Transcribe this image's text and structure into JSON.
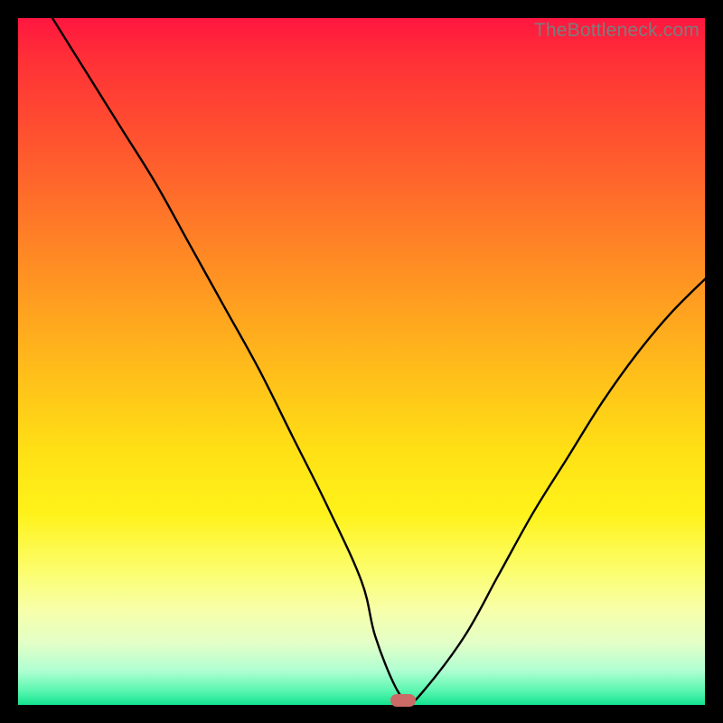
{
  "watermark": "TheBottleneck.com",
  "chart_data": {
    "type": "line",
    "title": "",
    "xlabel": "",
    "ylabel": "",
    "xlim": [
      0,
      100
    ],
    "ylim": [
      0,
      100
    ],
    "series": [
      {
        "name": "curve",
        "x": [
          5,
          10,
          15,
          20,
          25,
          30,
          35,
          40,
          45,
          50,
          52,
          55,
          57,
          59,
          65,
          70,
          75,
          80,
          85,
          90,
          95,
          100
        ],
        "y": [
          100,
          92,
          84,
          76,
          67,
          58,
          49,
          39,
          29,
          18,
          10,
          2.5,
          0.6,
          2,
          10,
          19,
          28,
          36,
          44,
          51,
          57,
          62
        ]
      }
    ],
    "marker": {
      "x": 56,
      "y": 0.6,
      "color": "#cb6a66"
    }
  },
  "colors": {
    "frame": "#000000",
    "curve": "#000000",
    "marker": "#cb6a66",
    "watermark": "#7c7c7c"
  }
}
